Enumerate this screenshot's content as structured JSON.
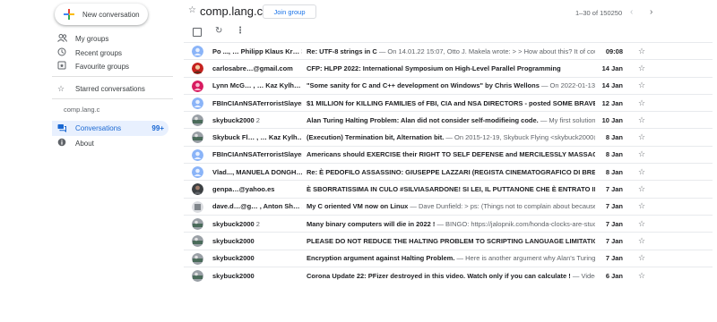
{
  "sidebar": {
    "new_conversation": "New conversation",
    "items": [
      {
        "label": "My groups",
        "icon": "people-icon"
      },
      {
        "label": "Recent groups",
        "icon": "history-icon"
      },
      {
        "label": "Favourite groups",
        "icon": "favourite-groups-icon"
      },
      {
        "label": "Starred conversations",
        "icon": "star-icon"
      }
    ],
    "section_label": "comp.lang.c",
    "active_item": {
      "label": "Conversations",
      "count": "99+",
      "icon": "conversations-icon"
    },
    "about": {
      "label": "About",
      "icon": "info-icon"
    }
  },
  "header": {
    "group_name": "comp.lang.c",
    "join_label": "Join group",
    "pager_text": "1–30 of 150250"
  },
  "threads": [
    {
      "authors": "Po ..., … Philipp Klaus Kr…",
      "count": "31",
      "subject": "Re: UTF-8 strings in C",
      "snippet": " — On 14.01.22 15:07, Otto J. Makela wrote: > > How about this? It of course …",
      "date": "09:08",
      "avatar": "blue"
    },
    {
      "authors": "carlosabre…@gmail.com",
      "count": "",
      "subject": "CFP: HLPP 2022: International Symposium on High-Level Parallel Programming",
      "snippet": "",
      "date": "14 Jan",
      "avatar": "photo-red"
    },
    {
      "authors": "Lynn McG… , … Kaz Kylh…",
      "count": "8",
      "subject": "\"Some sanity for C and C++ development on Windows\" by Chris Wellons",
      "snippet": " — On 2022-01-13, Öö Tiib…",
      "date": "14 Jan",
      "avatar": "magenta"
    },
    {
      "authors": "FBInCIAnNSATerroristSlayer",
      "count": "",
      "subject": "$1 MILLION for KILLING FAMILIES of FBI, CIA and NSA DIRECTORS - posted SOME BRAVE AMERICAN",
      "snippet": "",
      "date": "12 Jan",
      "avatar": "blue"
    },
    {
      "authors": "skybuck2000",
      "count": "2",
      "subject": "Alan Turing Halting Problem: Alan did not consider self-modifieing code.",
      "snippet": " — My first solution was …",
      "date": "10 Jan",
      "avatar": "photo-grey"
    },
    {
      "authors": "Skybuck Fl… , … Kaz Kylh…",
      "count": "8",
      "subject": "(Execution) Termination bit, Alternation bit.",
      "snippet": " — On 2015-12-19, Skybuck Flying <skybuck2000@hot…",
      "date": "8 Jan",
      "avatar": "photo-grey"
    },
    {
      "authors": "FBInCIAnNSATerroristSlayer",
      "count": "",
      "subject": "Americans should EXERCISE their RIGHT TO SELF DEFENSE and MERCILESSLY MASSACRE CIA NSA",
      "snippet": "",
      "date": "8 Jan",
      "avatar": "blue"
    },
    {
      "authors": "Vlad..., MANUELA DONGH…",
      "count": "2",
      "subject": "Re: È PEDOFILO ASSASSINO: GIUSEPPE LAZZARI (REGISTA CINEMATOGRAFICO DI BRESCIA, INCULA…",
      "snippet": "",
      "date": "8 Jan",
      "avatar": "blue"
    },
    {
      "authors": "genpa…@yahoo.es",
      "count": "",
      "subject": "È SBORRATISSIMA IN CULO #SILVIASARDONE! SI LEI, IL PUTTANONE CHE È ENTRATO IN POLITICA…",
      "snippet": "",
      "date": "7 Jan",
      "avatar": "photo-dark"
    },
    {
      "authors": "dave.d…@g… , Anton Sh…",
      "count": "2",
      "subject": "My C oriented VM now on Linux",
      "snippet": " — Dave Dunfield: > ps: (Things not to complain about because I > …",
      "date": "7 Jan",
      "avatar": "photo-light"
    },
    {
      "authors": "skybuck2000",
      "count": "2",
      "subject": "Many binary computers will die in 2022 !",
      "snippet": " — BINGO: https://jalopnik.com/honda-clocks-are-stuck-2…",
      "date": "7 Jan",
      "avatar": "photo-grey"
    },
    {
      "authors": "skybuck2000",
      "count": "",
      "subject": "PLEASE DO NOT REDUCE THE HALTING PROBLEM TO SCRIPTING LANGUAGE LIMITATIONS",
      "snippet": " — de…",
      "date": "7 Jan",
      "avatar": "photo-grey"
    },
    {
      "authors": "skybuck2000",
      "count": "",
      "subject": "Encryption argument against Halting Problem.",
      "snippet": " — Here is another argument why Alan's Turing resea…",
      "date": "7 Jan",
      "avatar": "photo-grey"
    },
    {
      "authors": "skybuck2000",
      "count": "",
      "subject": "Corona Update 22: PFizer destroyed in this video. Watch only if you can calculate !",
      "snippet": " — Video: https://…",
      "date": "6 Jan",
      "avatar": "photo-grey"
    }
  ],
  "colors": {
    "accent": "#1a73e8",
    "active_bg": "#e8f0fe",
    "active_text": "#1967d2"
  }
}
